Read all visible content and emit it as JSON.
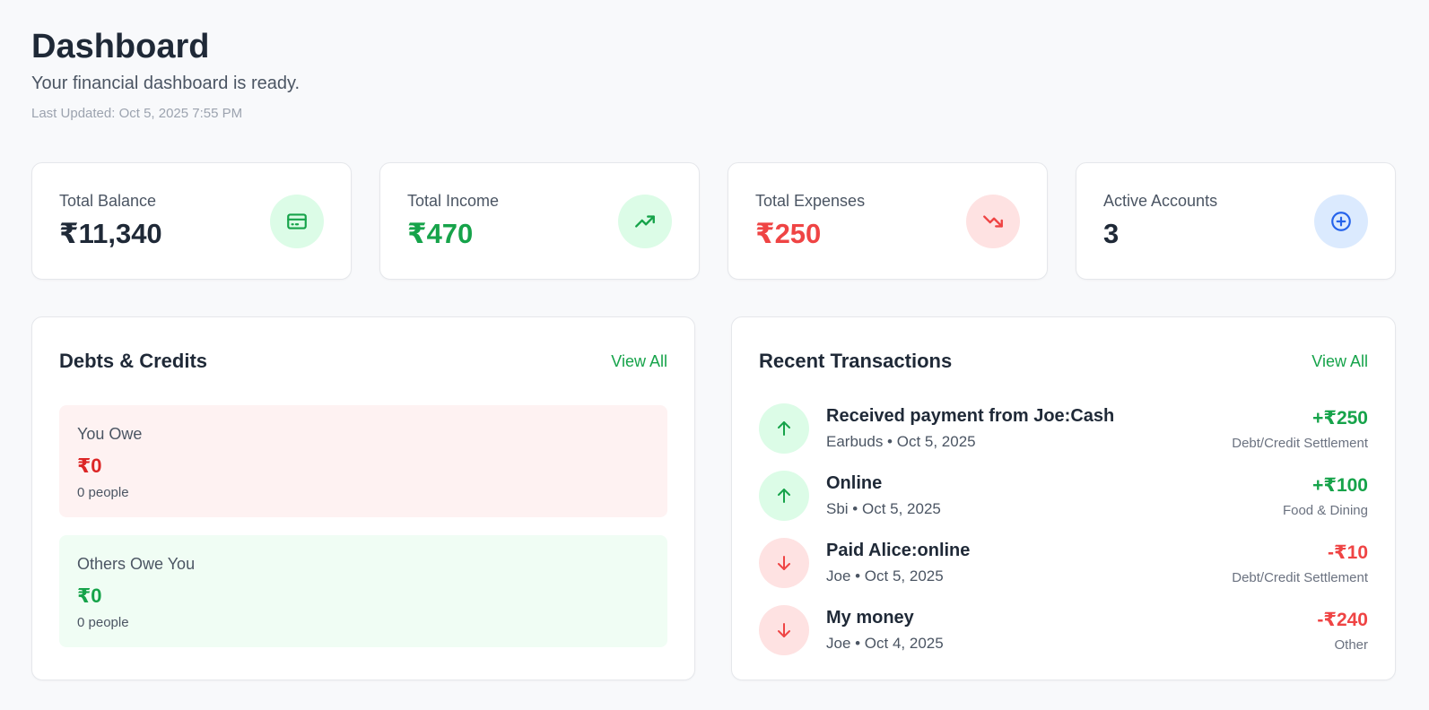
{
  "header": {
    "title": "Dashboard",
    "subtitle": "Your financial dashboard is ready.",
    "last_updated": "Last Updated: Oct 5, 2025 7:55 PM"
  },
  "stats": [
    {
      "label": "Total Balance",
      "value": "₹11,340",
      "icon": "credit-card-icon",
      "color": "#1f2937"
    },
    {
      "label": "Total Income",
      "value": "₹470",
      "icon": "trending-up-icon",
      "color": "#16a34a"
    },
    {
      "label": "Total Expenses",
      "value": "₹250",
      "icon": "trending-down-icon",
      "color": "#ef4444"
    },
    {
      "label": "Active Accounts",
      "value": "3",
      "icon": "plus-circle-icon",
      "color": "#1f2937"
    }
  ],
  "debts": {
    "title": "Debts & Credits",
    "view_all": "View All",
    "you_owe": {
      "label": "You Owe",
      "amount": "₹0",
      "people": "0 people"
    },
    "others_owe": {
      "label": "Others Owe You",
      "amount": "₹0",
      "people": "0 people"
    }
  },
  "transactions": {
    "title": "Recent Transactions",
    "view_all": "View All",
    "items": [
      {
        "title": "Received payment from Joe:Cash",
        "meta": "Earbuds • Oct 5, 2025",
        "amount": "+₹250",
        "category": "Debt/Credit Settlement",
        "direction": "in"
      },
      {
        "title": "Online",
        "meta": "Sbi • Oct 5, 2025",
        "amount": "+₹100",
        "category": "Food & Dining",
        "direction": "in"
      },
      {
        "title": "Paid Alice:online",
        "meta": "Joe • Oct 5, 2025",
        "amount": "-₹10",
        "category": "Debt/Credit Settlement",
        "direction": "out"
      },
      {
        "title": "My money",
        "meta": "Joe • Oct 4, 2025",
        "amount": "-₹240",
        "category": "Other",
        "direction": "out"
      }
    ]
  },
  "colors": {
    "accent_green": "#16a34a",
    "accent_red": "#ef4444",
    "accent_blue": "#2563eb"
  }
}
